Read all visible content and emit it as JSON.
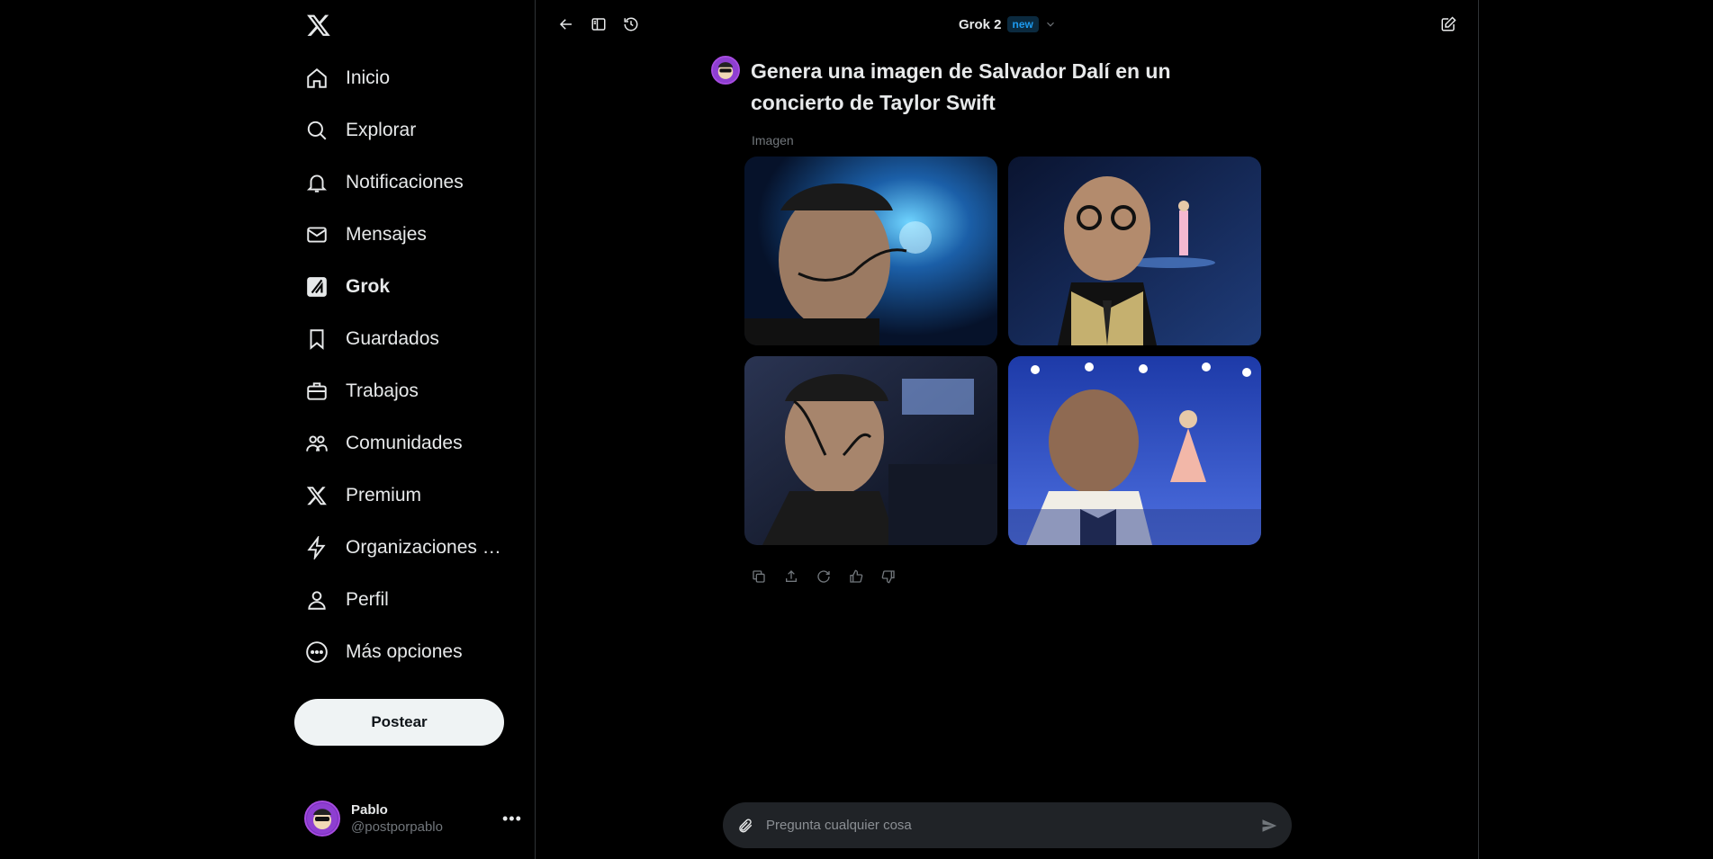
{
  "app": {
    "logo_icon": "x-logo-icon"
  },
  "sidebar": {
    "items": [
      {
        "label": "Inicio",
        "icon": "home-icon"
      },
      {
        "label": "Explorar",
        "icon": "search-icon"
      },
      {
        "label": "Notificaciones",
        "icon": "bell-icon"
      },
      {
        "label": "Mensajes",
        "icon": "mail-icon"
      },
      {
        "label": "Grok",
        "icon": "grok-icon",
        "active": true
      },
      {
        "label": "Guardados",
        "icon": "bookmark-icon"
      },
      {
        "label": "Trabajos",
        "icon": "briefcase-icon"
      },
      {
        "label": "Comunidades",
        "icon": "communities-icon"
      },
      {
        "label": "Premium",
        "icon": "x-premium-icon"
      },
      {
        "label": "Organizaciones verificadas",
        "icon": "lightning-icon"
      },
      {
        "label": "Perfil",
        "icon": "person-icon"
      },
      {
        "label": "Más opciones",
        "icon": "more-circle-icon"
      }
    ],
    "post_label": "Postear",
    "account": {
      "name": "Pablo",
      "handle": "@postporpablo"
    }
  },
  "topbar": {
    "model_name": "Grok 2",
    "model_badge": "new",
    "icons": [
      "back-arrow-icon",
      "sidebar-toggle-icon",
      "history-icon",
      "compose-icon"
    ]
  },
  "chat": {
    "question": "Genera una imagen de Salvador Dalí en un concierto de Taylor Swift",
    "attachment_label": "Imagen",
    "image_count": 4,
    "actions": [
      "copy-icon",
      "share-icon",
      "regenerate-icon",
      "thumbs-up-icon",
      "thumbs-down-icon"
    ]
  },
  "input": {
    "placeholder": "Pregunta cualquier cosa",
    "value": ""
  },
  "colors": {
    "background": "#000000",
    "text": "#e7e9ea",
    "muted": "#71767b",
    "accent": "#1d9bf0",
    "divider": "#2f3336"
  }
}
